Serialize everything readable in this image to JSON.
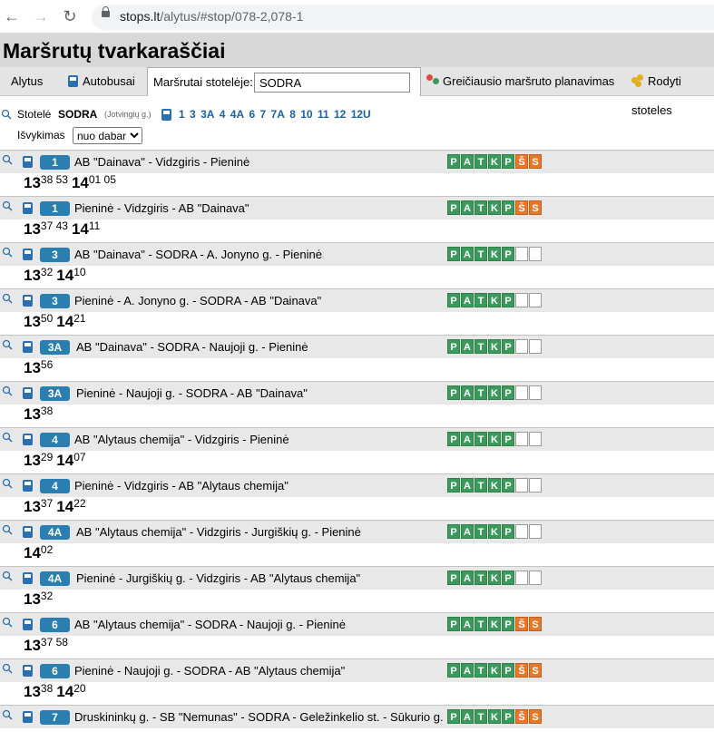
{
  "browser": {
    "url_host": "stops.lt",
    "url_path": "/alytus/#stop/078-2,078-1"
  },
  "page": {
    "title": "Maršrutų tvarkaraščiai"
  },
  "tabs": {
    "city": "Alytus",
    "buses": "Autobusai",
    "routes_at_stop": "Maršrutai stotelėje:",
    "stop_search_value": "SODRA",
    "planner": "Greičiausio maršruto planavimas",
    "show_stops": "Rodyti stoteles"
  },
  "stop": {
    "label": "Stotelė",
    "name": "SODRA",
    "street": "(Jotvingių g.)",
    "route_links": [
      "1",
      "3",
      "3A",
      "4",
      "4A",
      "6",
      "7",
      "7A",
      "8",
      "10",
      "11",
      "12",
      "12U"
    ],
    "departure_label": "Išvykimas",
    "departure_value": "nuo dabar",
    "departure_options": [
      "nuo dabar"
    ]
  },
  "day_letters": [
    "P",
    "A",
    "T",
    "K",
    "P",
    "Š",
    "S"
  ],
  "colors": {
    "workday": "#3a9a5c",
    "weekend": "#e8772a",
    "route_badge": "#2a7fb0",
    "link": "#1a61a3"
  },
  "routes": [
    {
      "num": "1",
      "name": "AB \"Dainava\" - Vidzgiris - Pieninė",
      "weekend": true,
      "times": [
        {
          "h": "13",
          "m": "38 53"
        },
        {
          "h": "14",
          "m": "01 05"
        }
      ]
    },
    {
      "num": "1",
      "name": "Pieninė - Vidzgiris - AB \"Dainava\"",
      "weekend": true,
      "times": [
        {
          "h": "13",
          "m": "37 43"
        },
        {
          "h": "14",
          "m": "11"
        }
      ]
    },
    {
      "num": "3",
      "name": "AB \"Dainava\" - SODRA - A. Jonyno g. - Pieninė",
      "weekend": false,
      "times": [
        {
          "h": "13",
          "m": "32"
        },
        {
          "h": "14",
          "m": "10"
        }
      ]
    },
    {
      "num": "3",
      "name": "Pieninė - A. Jonyno g. - SODRA - AB \"Dainava\"",
      "weekend": false,
      "times": [
        {
          "h": "13",
          "m": "50"
        },
        {
          "h": "14",
          "m": "21"
        }
      ]
    },
    {
      "num": "3A",
      "name": "AB \"Dainava\" - SODRA - Naujoji g. - Pieninė",
      "weekend": false,
      "times": [
        {
          "h": "13",
          "m": "56"
        }
      ]
    },
    {
      "num": "3A",
      "name": "Pieninė - Naujoji g. - SODRA - AB \"Dainava\"",
      "weekend": false,
      "times": [
        {
          "h": "13",
          "m": "38"
        }
      ]
    },
    {
      "num": "4",
      "name": "AB \"Alytaus chemija\" - Vidzgiris - Pieninė",
      "weekend": false,
      "times": [
        {
          "h": "13",
          "m": "29"
        },
        {
          "h": "14",
          "m": "07"
        }
      ]
    },
    {
      "num": "4",
      "name": "Pieninė - Vidzgiris - AB \"Alytaus chemija\"",
      "weekend": false,
      "times": [
        {
          "h": "13",
          "m": "37"
        },
        {
          "h": "14",
          "m": "22"
        }
      ]
    },
    {
      "num": "4A",
      "name": "AB \"Alytaus chemija\" - Vidzgiris - Jurgiškių g. - Pieninė",
      "weekend": false,
      "times": [
        {
          "h": "14",
          "m": "02"
        }
      ]
    },
    {
      "num": "4A",
      "name": "Pieninė - Jurgiškių g. - Vidzgiris - AB \"Alytaus chemija\"",
      "weekend": false,
      "times": [
        {
          "h": "13",
          "m": "32"
        }
      ]
    },
    {
      "num": "6",
      "name": "AB \"Alytaus chemija\" - SODRA - Naujoji g. - Pieninė",
      "weekend": true,
      "times": [
        {
          "h": "13",
          "m": "37 58"
        }
      ]
    },
    {
      "num": "6",
      "name": "Pieninė - Naujoji g. - SODRA - AB \"Alytaus chemija\"",
      "weekend": true,
      "times": [
        {
          "h": "13",
          "m": "38"
        },
        {
          "h": "14",
          "m": "20"
        }
      ]
    },
    {
      "num": "7",
      "name": "Druskininkų g. - SB \"Nemunas\" - SODRA - Geležinkelio st. - Sūkurio g.",
      "weekend": true,
      "times": []
    }
  ]
}
